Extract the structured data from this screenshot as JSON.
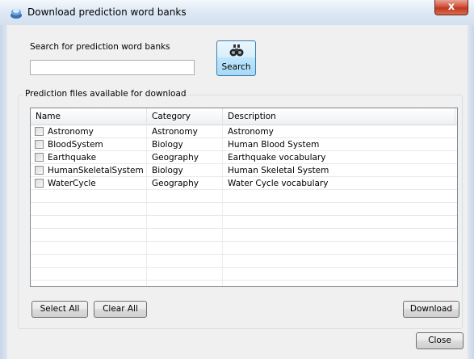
{
  "window": {
    "title": "Download prediction word banks",
    "close_glyph": "x"
  },
  "search": {
    "label": "Search for prediction word banks",
    "value": "",
    "placeholder": "",
    "button_label": "Search",
    "button_icon": "binoculars-icon"
  },
  "files": {
    "group_label": "Prediction files available for download",
    "columns": [
      "Name",
      "Category",
      "Description"
    ],
    "rows": [
      {
        "name": "Astronomy",
        "category": "Astronomy",
        "description": "Astronomy",
        "checked": false
      },
      {
        "name": "BloodSystem",
        "category": "Biology",
        "description": "Human Blood System",
        "checked": false
      },
      {
        "name": "Earthquake",
        "category": "Geography",
        "description": "Earthquake vocabulary",
        "checked": false
      },
      {
        "name": "HumanSkeletalSystem",
        "category": "Biology",
        "description": "Human Skeletal System",
        "checked": false
      },
      {
        "name": "WaterCycle",
        "category": "Geography",
        "description": "Water Cycle vocabulary",
        "checked": false
      }
    ]
  },
  "buttons": {
    "select_all": "Select All",
    "clear_all": "Clear All",
    "download": "Download",
    "close": "Close"
  }
}
